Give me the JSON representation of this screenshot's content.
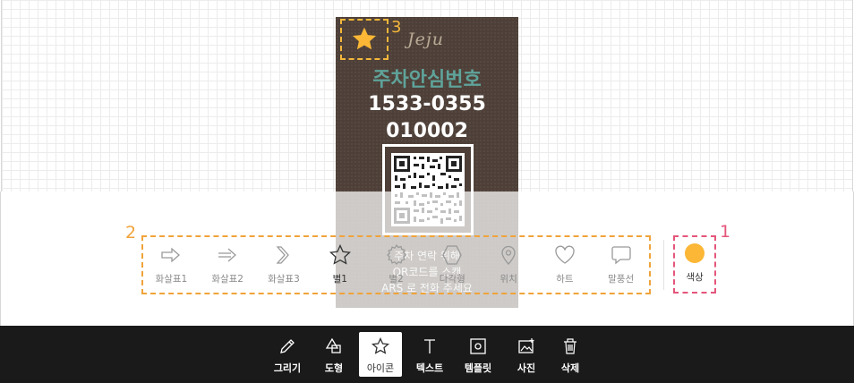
{
  "sign": {
    "logo": "Jeju",
    "title": "주차안심번호",
    "phone": "1533-0355",
    "code": "010002",
    "bottom_line_1": "주차 연락 위해",
    "bottom_line_2": "QR코드를 스캔",
    "bottom_line_3": "ARS 로 전화 주세요",
    "colors": {
      "background": "#4e4038",
      "title": "#5fa39a"
    }
  },
  "annotations": {
    "n1": "1",
    "n2": "2",
    "n3": "3"
  },
  "icon_panel": {
    "items": [
      {
        "label": "화살표1",
        "icon": "arrow-outline-icon"
      },
      {
        "label": "화살표2",
        "icon": "arrow-thin-icon"
      },
      {
        "label": "화살표3",
        "icon": "chevron-double-icon"
      },
      {
        "label": "별1",
        "icon": "star-icon"
      },
      {
        "label": "별2",
        "icon": "badge-star-icon"
      },
      {
        "label": "다각형",
        "icon": "hexagon-icon"
      },
      {
        "label": "위치",
        "icon": "location-pin-icon"
      },
      {
        "label": "하트",
        "icon": "heart-icon"
      },
      {
        "label": "말풍선",
        "icon": "speech-bubble-icon"
      }
    ],
    "active_index": 3
  },
  "color_picker": {
    "label": "색상",
    "value": "#fbb735"
  },
  "toolbar": {
    "items": [
      {
        "label": "그리기",
        "icon": "pencil-icon"
      },
      {
        "label": "도형",
        "icon": "shapes-icon"
      },
      {
        "label": "아이콘",
        "icon": "star-icon"
      },
      {
        "label": "텍스트",
        "icon": "text-icon"
      },
      {
        "label": "템플릿",
        "icon": "template-icon"
      },
      {
        "label": "사진",
        "icon": "photo-icon"
      },
      {
        "label": "삭제",
        "icon": "trash-icon"
      }
    ],
    "active_index": 2
  },
  "selected_star_color": "#fbb735"
}
